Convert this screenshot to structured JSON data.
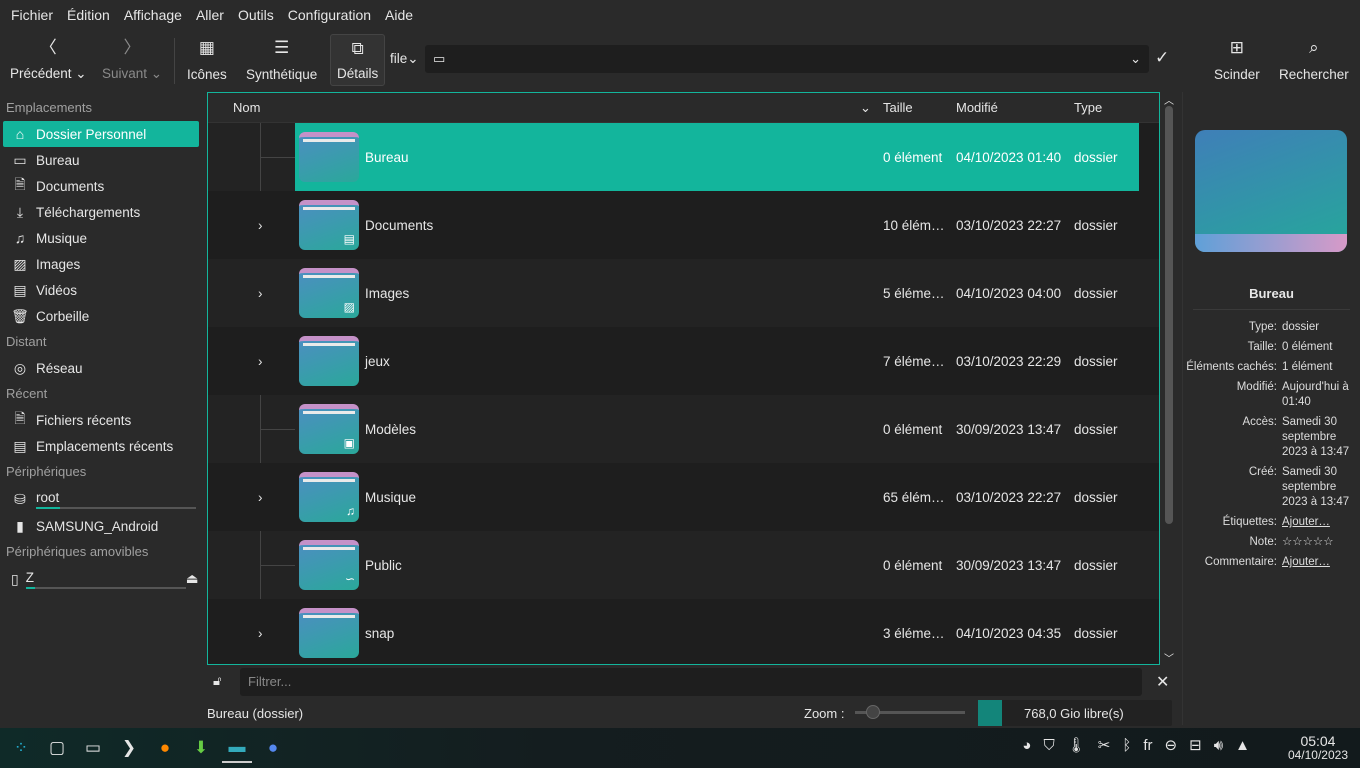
{
  "menu": [
    "Fichier",
    "Édition",
    "Affichage",
    "Aller",
    "Outils",
    "Configuration",
    "Aide"
  ],
  "toolbar": {
    "back": "Précédent",
    "forward": "Suivant",
    "icons": "Icônes",
    "compact": "Synthétique",
    "details": "Détails",
    "protocol": "file",
    "split": "Scinder",
    "search": "Rechercher"
  },
  "sidebar": {
    "sections": [
      {
        "title": "Emplacements",
        "items": [
          {
            "label": "Dossier Personnel",
            "icon": "⌂"
          },
          {
            "label": "Bureau",
            "icon": "▭"
          },
          {
            "label": "Documents",
            "icon": "🗎"
          },
          {
            "label": "Téléchargements",
            "icon": "⤓"
          },
          {
            "label": "Musique",
            "icon": "♫"
          },
          {
            "label": "Images",
            "icon": "▨"
          },
          {
            "label": "Vidéos",
            "icon": "▤"
          },
          {
            "label": "Corbeille",
            "icon": "🗑"
          }
        ]
      },
      {
        "title": "Distant",
        "items": [
          {
            "label": "Réseau",
            "icon": "◎"
          }
        ]
      },
      {
        "title": "Récent",
        "items": [
          {
            "label": "Fichiers récents",
            "icon": "🗎"
          },
          {
            "label": "Emplacements récents",
            "icon": "▤"
          }
        ]
      },
      {
        "title": "Périphériques",
        "items": [
          {
            "label": "root",
            "icon": "⛁",
            "usage": 0.15
          },
          {
            "label": "SAMSUNG_Android",
            "icon": "▮"
          }
        ]
      },
      {
        "title": "Périphériques amovibles",
        "items": [
          {
            "label": "Z",
            "icon": "▯",
            "usage": 0.06
          }
        ]
      }
    ]
  },
  "columns": {
    "name": "Nom",
    "size": "Taille",
    "modified": "Modifié",
    "type": "Type"
  },
  "files": [
    {
      "name": "Bureau",
      "size": "0 élément",
      "modified": "04/10/2023 01:40",
      "type": "dossier",
      "expandable": false,
      "selected": true,
      "sub": ""
    },
    {
      "name": "Documents",
      "size": "10 élém…",
      "modified": "03/10/2023 22:27",
      "type": "dossier",
      "expandable": true,
      "sub": "▤"
    },
    {
      "name": "Images",
      "size": "5 éléme…",
      "modified": "04/10/2023 04:00",
      "type": "dossier",
      "expandable": true,
      "sub": "▨"
    },
    {
      "name": "jeux",
      "size": "7 éléme…",
      "modified": "03/10/2023 22:29",
      "type": "dossier",
      "expandable": true,
      "sub": ""
    },
    {
      "name": "Modèles",
      "size": "0 élément",
      "modified": "30/09/2023 13:47",
      "type": "dossier",
      "expandable": false,
      "sub": "▣"
    },
    {
      "name": "Musique",
      "size": "65 élém…",
      "modified": "03/10/2023 22:27",
      "type": "dossier",
      "expandable": true,
      "sub": "♫"
    },
    {
      "name": "Public",
      "size": "0 élément",
      "modified": "30/09/2023 13:47",
      "type": "dossier",
      "expandable": false,
      "sub": "∽"
    },
    {
      "name": "snap",
      "size": "3 éléme…",
      "modified": "04/10/2023 04:35",
      "type": "dossier",
      "expandable": true,
      "sub": ""
    }
  ],
  "info": {
    "title": "Bureau",
    "fields": [
      {
        "k": "Type:",
        "v": "dossier"
      },
      {
        "k": "Taille:",
        "v": "0 élément"
      },
      {
        "k": "Éléments cachés:",
        "v": "1 élément"
      },
      {
        "k": "Modifié:",
        "v": "Aujourd'hui à 01:40"
      },
      {
        "k": "Accès:",
        "v": "Samedi 30 septembre 2023 à 13:47"
      },
      {
        "k": "Créé:",
        "v": "Samedi 30 septembre 2023 à 13:47"
      }
    ],
    "tags_label": "Étiquettes:",
    "tags_link": "Ajouter…",
    "rating_label": "Note:",
    "rating": 0,
    "comment_label": "Commentaire:",
    "comment_link": "Ajouter…"
  },
  "filter": {
    "placeholder": "Filtrer..."
  },
  "status": {
    "text": "Bureau (dossier)",
    "zoom_label": "Zoom :",
    "zoom_value": 0.1,
    "free_space": "768,0 Gio libre(s)"
  },
  "clock": {
    "time": "05:04",
    "date": "04/10/2023"
  },
  "tray": {
    "lang": "fr"
  },
  "colors": {
    "accent": "#13b59c"
  }
}
